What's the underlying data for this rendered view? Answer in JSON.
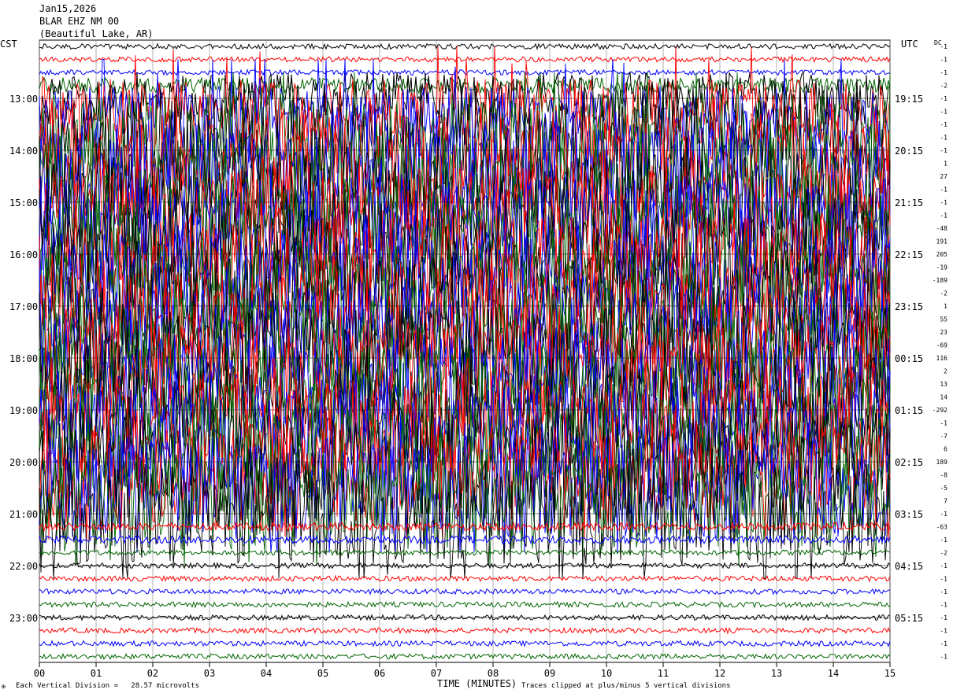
{
  "header": {
    "date": "Jan15,2026",
    "station": "BLAR EHZ NM 00",
    "location": "(Beautiful Lake, AR)"
  },
  "footer": {
    "scale_note": "Each Vertical Division =   28.57 microvolts",
    "clip_note": "Traces clipped at plus/minus 5 vertical divisions",
    "mark": "✠"
  },
  "colors": {
    "trace_cycle": [
      "#000000",
      "#ff0000",
      "#0000ff",
      "#006400"
    ],
    "grid": "#808080"
  },
  "chart_data": {
    "type": "line",
    "title": "Jan15,2026 BLAR EHZ NM 00 (Beautiful Lake, AR)",
    "xlabel": "TIME (MINUTES)",
    "xlim": [
      0,
      15
    ],
    "x_ticks": [
      "00",
      "01",
      "02",
      "03",
      "04",
      "05",
      "06",
      "07",
      "08",
      "09",
      "10",
      "11",
      "12",
      "13",
      "14",
      "15"
    ],
    "left_axis_label": "CST",
    "right_axis_label": "UTC",
    "dc_label": "DC",
    "rows_per_hour": 4,
    "row_count": 48,
    "left_hour_labels": [
      "13:00",
      "14:00",
      "15:00",
      "16:00",
      "17:00",
      "18:00",
      "19:00",
      "20:00",
      "21:00",
      "22:00",
      "23:00"
    ],
    "right_hour_labels": [
      "19:15",
      "20:15",
      "21:15",
      "22:15",
      "23:15",
      "00:15",
      "01:15",
      "02:15",
      "03:15",
      "04:15",
      "05:15"
    ],
    "first_labeled_row": 4,
    "dc_offsets": [
      "-1",
      "-1",
      "-1",
      "-2",
      "-1",
      "-1",
      "-1",
      "-1",
      "-1",
      "1",
      "27",
      "-1",
      "-1",
      "-1",
      "-48",
      "191",
      "205",
      "-19",
      "-189",
      "-2",
      "1",
      "55",
      "23",
      "-69",
      "116",
      "2",
      "13",
      "14",
      "-292",
      "-1",
      "-7",
      "6",
      "189",
      "-8",
      "-5",
      "7",
      "-1",
      "-63",
      "-1",
      "-2",
      "-1",
      "-1",
      "-1",
      "-1",
      "-1",
      "-1",
      "-1",
      "-1"
    ],
    "clip_divisions": 5,
    "microvolts_per_division": 28.57,
    "row_amplitude": [
      0.2,
      0.2,
      0.2,
      0.6,
      2.0,
      2.5,
      3.0,
      3.5,
      4,
      4,
      4,
      4,
      4,
      4,
      4,
      4,
      4,
      4,
      4,
      4,
      4,
      4,
      4,
      4,
      4,
      4,
      4,
      4,
      4,
      4,
      4,
      4,
      4,
      4,
      4,
      4,
      4,
      0.3,
      0.3,
      0.2,
      0.2,
      0.2,
      0.2,
      0.2,
      0.2,
      0.2,
      0.2,
      0.2
    ],
    "grid": true
  }
}
